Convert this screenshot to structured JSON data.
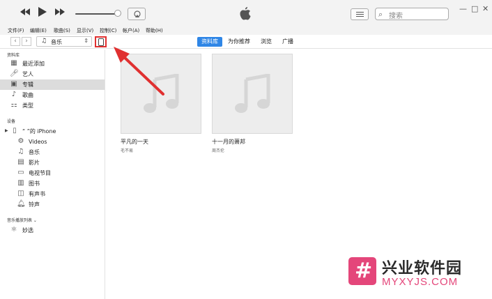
{
  "titlebar": {
    "search_placeholder": "搜索",
    "window_controls": [
      "—",
      "□",
      "✕"
    ]
  },
  "menu": [
    "文件(F)",
    "编辑(E)",
    "歌曲(S)",
    "显示(V)",
    "控制(C)",
    "帐户(A)",
    "帮助(H)"
  ],
  "toolbar": {
    "media_type": "音乐",
    "tabs": [
      {
        "label": "资料库",
        "active": true
      },
      {
        "label": "为你推荐",
        "active": false
      },
      {
        "label": "浏览",
        "active": false
      },
      {
        "label": "广播",
        "active": false
      }
    ]
  },
  "sidebar": {
    "library_heading": "资料库",
    "library_items": [
      {
        "icon": "recently-added-icon",
        "label": "最近添加",
        "selected": false
      },
      {
        "icon": "artist-icon",
        "label": "艺人",
        "selected": false
      },
      {
        "icon": "album-icon",
        "label": "专辑",
        "selected": true
      },
      {
        "icon": "song-icon",
        "label": "歌曲",
        "selected": false
      },
      {
        "icon": "genre-icon",
        "label": "类型",
        "selected": false
      }
    ],
    "devices_heading": "设备",
    "device_name": "“          ”的 iPhone",
    "device_items": [
      {
        "icon": "videos-icon",
        "label": "Videos"
      },
      {
        "icon": "music-icon",
        "label": "音乐"
      },
      {
        "icon": "movies-icon",
        "label": "影片"
      },
      {
        "icon": "tv-icon",
        "label": "电视节目"
      },
      {
        "icon": "books-icon",
        "label": "图书"
      },
      {
        "icon": "audiobooks-icon",
        "label": "有声书"
      },
      {
        "icon": "ringtones-icon",
        "label": "铃声"
      }
    ],
    "playlists_heading": "音乐播放列表 ⌄",
    "playlist_items": [
      {
        "icon": "genius-icon",
        "label": "妙选"
      }
    ]
  },
  "albums": [
    {
      "title": "平凡的一天",
      "artist": "毛不易"
    },
    {
      "title": "十一月的萧邦",
      "artist": "周杰伦"
    }
  ],
  "watermark": {
    "name": "兴业软件园",
    "url": "MYXYJS.COM",
    "logo_char": "#"
  },
  "colors": {
    "accent": "#2f86e6",
    "annotation": "#e03030",
    "watermark": "#e4467a"
  }
}
